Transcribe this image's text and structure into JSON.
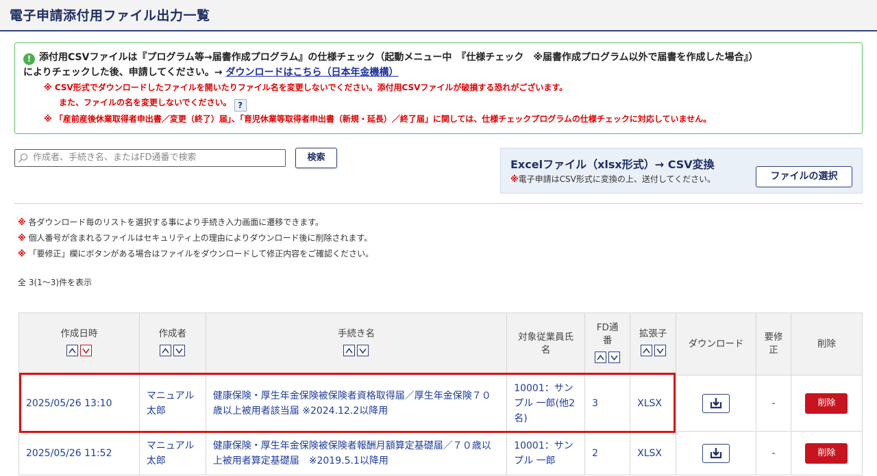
{
  "page": {
    "title": "電子申請添付用ファイル出力一覧"
  },
  "notice": {
    "line1_prefix": "添付用CSVファイルは『プログラム等→届書作成プログラム』の仕様チェック（起動メニュー中　『仕様チェック　※届書作成プログラム以外で届書を作成した場合』）",
    "line2_prefix": "によりチェックした後、申請してください。→ ",
    "link": "ダウンロードはこちら（日本年金機構）",
    "warn1": "※ CSV形式でダウンロードしたファイルを開いたりファイル名を変更しないでください。添付用CSVファイルが破損する恐れがございます。",
    "warn2": "また、ファイルの名を変更しないでください。",
    "help": "?",
    "warn3": "※ 「産前産後休業取得者申出書／変更（終了）届」、「育児休業等取得者申出書（新規・延長）／終了届」に関しては、仕様チェックプログラムの仕様チェックに対応していません。"
  },
  "search": {
    "placeholder": "作成者、手続き名、またはFD通番で検索",
    "button": "検索"
  },
  "convert": {
    "title": "Excelファイル（xlsx形式）→ CSV変換",
    "mark": "※",
    "note": "電子申請はCSV形式に変換の上、送付してください。",
    "button": "ファイルの選択"
  },
  "notes": [
    {
      "mark": "※",
      "text": " 各ダウンロード毎のリストを選択する事により手続き入力画面に遷移できます。"
    },
    {
      "mark": "※",
      "text": " 個人番号が含まれるファイルはセキュリティ上の理由によりダウンロード後に削除されます。"
    },
    {
      "mark": "※",
      "text": " 「要修正」欄にボタンがある場合はファイルをダウンロードして修正内容をご確認ください。"
    }
  ],
  "count": "全 3(1～3)件を表示",
  "table": {
    "headers": {
      "date": "作成日時",
      "creator": "作成者",
      "procedure": "手続き名",
      "employee": "対象従業員氏名",
      "fd": "FD通番",
      "ext": "拡張子",
      "download": "ダウンロード",
      "fix": "要修正",
      "delete": "削除"
    },
    "rows": [
      {
        "date": "2025/05/26 13:10",
        "creator": "マニュアル太郎",
        "procedure": "健康保険・厚生年金保険被保険者資格取得届／厚生年金保険７０歳以上被用者該当届 ※2024.12.2以降用",
        "employee": "10001：サンプル 一郎(他2名)",
        "fd": "3",
        "ext": "XLSX",
        "fix": "-",
        "delete": "削除"
      },
      {
        "date": "2025/05/26 11:52",
        "creator": "マニュアル太郎",
        "procedure": "健康保険・厚生年金保険被保険者報酬月額算定基礎届／７０歳以上被用者算定基礎届　※2019.5.1以降用",
        "employee": "10001：サンプル 一郎",
        "fd": "2",
        "ext": "XLSX",
        "fix": "-",
        "delete": "削除"
      }
    ]
  },
  "colors": {
    "accent": "#1f2f66",
    "link": "#1d3ba0",
    "danger": "#c8141f",
    "warn": "#e00000",
    "notice_border": "#5bbf5b"
  }
}
